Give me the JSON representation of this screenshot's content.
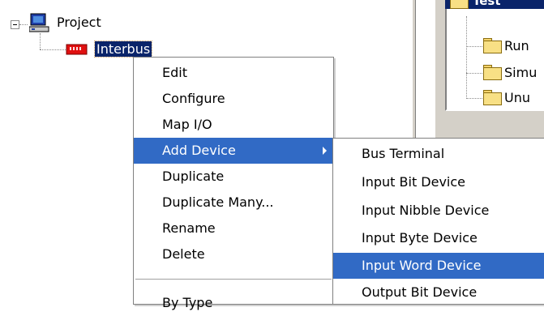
{
  "tree": {
    "project_label": "Project",
    "interbus_label": "Interbus"
  },
  "right_pane": {
    "header_title": "Test",
    "items": [
      "Run",
      "Simu",
      "Unu"
    ]
  },
  "context_menu": {
    "items": [
      "Edit",
      "Configure",
      "Map I/O",
      "Add Device",
      "Duplicate",
      "Duplicate Many...",
      "Rename",
      "Delete"
    ],
    "highlighted": "Add Device",
    "partial_item": "By Type"
  },
  "submenu": {
    "items": [
      "Bus Terminal",
      "Input Bit Device",
      "Input Nibble Device",
      "Input Byte Device",
      "Input Word Device",
      "Output Bit Device"
    ],
    "highlighted": "Input Word Device"
  },
  "colors": {
    "menu_highlight": "#316ac5",
    "tree_selection": "#0a246a"
  }
}
